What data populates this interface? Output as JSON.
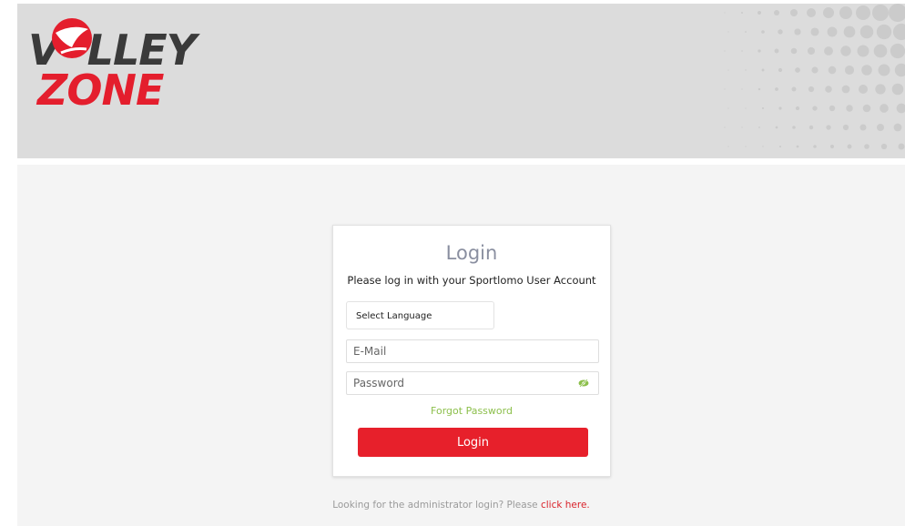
{
  "header": {
    "logo_top": "V LLEY",
    "logo_bottom": "ZONE",
    "logo_icon": "volleyball-icon",
    "background_color": "#dcdcdc"
  },
  "login": {
    "title": "Login",
    "subtitle": "Please log in with your Sportlomo User Account",
    "language_select": {
      "selected": "Select Language"
    },
    "email": {
      "placeholder": "E-Mail",
      "value": ""
    },
    "password": {
      "placeholder": "Password",
      "value": "",
      "toggle_icon": "eye-slash-icon"
    },
    "forgot_password": "Forgot Password",
    "login_button": "Login"
  },
  "admin": {
    "text": "Looking for the administrator login? Please ",
    "link": "click here."
  },
  "colors": {
    "accent_red": "#e7202b",
    "link_green": "#8cbf4b",
    "title_gray": "#8a8fa0"
  }
}
